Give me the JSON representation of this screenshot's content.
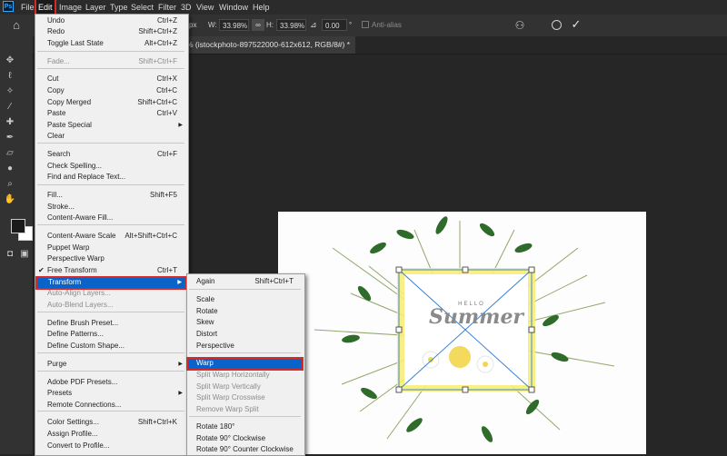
{
  "menubar": {
    "items": [
      "File",
      "Edit",
      "Image",
      "Layer",
      "Type",
      "Select",
      "Filter",
      "3D",
      "View",
      "Window",
      "Help"
    ]
  },
  "options": {
    "w_label": "W:",
    "w_value": "33.98%",
    "h_label": "H:",
    "h_value": "33.98%",
    "angle_value": "0.00",
    "angle_unit": "°",
    "units_label": "px",
    "antialias_label": "Anti-alias"
  },
  "document": {
    "tab_title": "% (istockphoto-897522000-612x612, RGB/8#) *"
  },
  "canvas": {
    "hello_text": "HELLO",
    "summer_text": "Summer"
  },
  "edit_menu": {
    "items": [
      {
        "label": "Undo",
        "shortcut": "Ctrl+Z"
      },
      {
        "label": "Redo",
        "shortcut": "Shift+Ctrl+Z"
      },
      {
        "label": "Toggle Last State",
        "shortcut": "Alt+Ctrl+Z"
      },
      {
        "label": "Fade...",
        "shortcut": "Shift+Ctrl+F"
      },
      {
        "label": "Cut",
        "shortcut": "Ctrl+X"
      },
      {
        "label": "Copy",
        "shortcut": "Ctrl+C"
      },
      {
        "label": "Copy Merged",
        "shortcut": "Shift+Ctrl+C"
      },
      {
        "label": "Paste",
        "shortcut": "Ctrl+V"
      },
      {
        "label": "Paste Special",
        "shortcut": ""
      },
      {
        "label": "Clear",
        "shortcut": ""
      },
      {
        "label": "Search",
        "shortcut": "Ctrl+F"
      },
      {
        "label": "Check Spelling...",
        "shortcut": ""
      },
      {
        "label": "Find and Replace Text...",
        "shortcut": ""
      },
      {
        "label": "Fill...",
        "shortcut": "Shift+F5"
      },
      {
        "label": "Stroke...",
        "shortcut": ""
      },
      {
        "label": "Content-Aware Fill...",
        "shortcut": ""
      },
      {
        "label": "Content-Aware Scale",
        "shortcut": "Alt+Shift+Ctrl+C"
      },
      {
        "label": "Puppet Warp",
        "shortcut": ""
      },
      {
        "label": "Perspective Warp",
        "shortcut": ""
      },
      {
        "label": "Free Transform",
        "shortcut": "Ctrl+T"
      },
      {
        "label": "Transform",
        "shortcut": ""
      },
      {
        "label": "Auto-Align Layers...",
        "shortcut": ""
      },
      {
        "label": "Auto-Blend Layers...",
        "shortcut": ""
      },
      {
        "label": "Define Brush Preset...",
        "shortcut": ""
      },
      {
        "label": "Define Patterns...",
        "shortcut": ""
      },
      {
        "label": "Define Custom Shape...",
        "shortcut": ""
      },
      {
        "label": "Purge",
        "shortcut": ""
      },
      {
        "label": "Adobe PDF Presets...",
        "shortcut": ""
      },
      {
        "label": "Presets",
        "shortcut": ""
      },
      {
        "label": "Remote Connections...",
        "shortcut": ""
      },
      {
        "label": "Color Settings...",
        "shortcut": "Shift+Ctrl+K"
      },
      {
        "label": "Assign Profile...",
        "shortcut": ""
      },
      {
        "label": "Convert to Profile...",
        "shortcut": ""
      }
    ]
  },
  "transform_menu": {
    "items": [
      {
        "label": "Again",
        "shortcut": "Shift+Ctrl+T"
      },
      {
        "label": "Scale",
        "shortcut": ""
      },
      {
        "label": "Rotate",
        "shortcut": ""
      },
      {
        "label": "Skew",
        "shortcut": ""
      },
      {
        "label": "Distort",
        "shortcut": ""
      },
      {
        "label": "Perspective",
        "shortcut": ""
      },
      {
        "label": "Warp",
        "shortcut": ""
      },
      {
        "label": "Split Warp Horizontally",
        "shortcut": ""
      },
      {
        "label": "Split Warp Vertically",
        "shortcut": ""
      },
      {
        "label": "Split Warp Crosswise",
        "shortcut": ""
      },
      {
        "label": "Remove Warp Split",
        "shortcut": ""
      },
      {
        "label": "Rotate 180°",
        "shortcut": ""
      },
      {
        "label": "Rotate 90° Clockwise",
        "shortcut": ""
      },
      {
        "label": "Rotate 90° Counter Clockwise",
        "shortcut": ""
      }
    ]
  },
  "colors": {
    "highlight": "#0a63c9",
    "annotation_red": "#d42a2a",
    "menu_bg": "#f0f0f0",
    "app_bg": "#262626"
  }
}
